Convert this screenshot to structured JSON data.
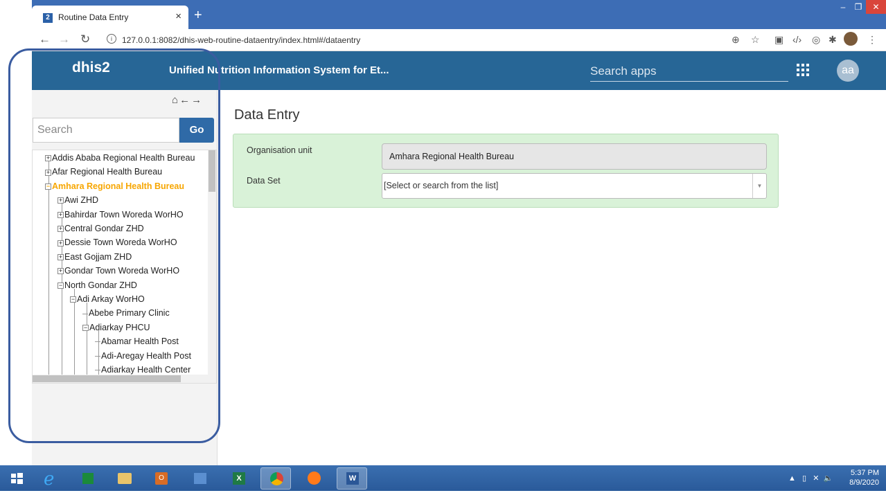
{
  "browser": {
    "tab_number": "2",
    "tab_title": "Routine Data Entry",
    "tab_close": "×",
    "new_tab": "+",
    "url": "127.0.0.1:8082/dhis-web-routine-dataentry/index.html#/dataentry",
    "url_info": "i"
  },
  "header": {
    "logo": "dhis2",
    "title": "Unified Nutrition Information System for Et...",
    "search_placeholder": "Search apps",
    "avatar": "aa"
  },
  "sidebar": {
    "search_placeholder": "Search",
    "go_label": "Go",
    "tree": [
      {
        "label": "Addis Ababa Regional Health Bureau",
        "symbol": "+",
        "level": 0
      },
      {
        "label": "Afar Regional Health Bureau",
        "symbol": "+",
        "level": 0
      },
      {
        "label": "Amhara Regional Health Bureau",
        "symbol": "−",
        "level": 0,
        "active": true
      },
      {
        "label": "Awi ZHD",
        "symbol": "+",
        "level": 1
      },
      {
        "label": "Bahirdar Town Woreda WorHO",
        "symbol": "+",
        "level": 1
      },
      {
        "label": "Central Gondar ZHD",
        "symbol": "+",
        "level": 1
      },
      {
        "label": "Dessie Town Woreda WorHO",
        "symbol": "+",
        "level": 1
      },
      {
        "label": "East Gojjam ZHD",
        "symbol": "+",
        "level": 1
      },
      {
        "label": "Gondar Town Woreda WorHO",
        "symbol": "+",
        "level": 1
      },
      {
        "label": "North Gondar ZHD",
        "symbol": "−",
        "level": 1
      },
      {
        "label": "Adi Arkay WorHO",
        "symbol": "−",
        "level": 2
      },
      {
        "label": "Abebe Primary Clinic",
        "symbol": "",
        "level": 3
      },
      {
        "label": "Adiarkay PHCU",
        "symbol": "−",
        "level": 3
      },
      {
        "label": "Abamar Health Post",
        "symbol": "",
        "level": 4
      },
      {
        "label": "Adi-Aregay Health Post",
        "symbol": "",
        "level": 4
      },
      {
        "label": "Adiarkay Health Center",
        "symbol": "",
        "level": 4
      }
    ]
  },
  "main": {
    "title": "Data Entry",
    "org_unit_label": "Organisation unit",
    "org_unit_value": "Amhara Regional Health Bureau",
    "data_set_label": "Data Set",
    "data_set_placeholder": "[Select or search from the list]"
  },
  "taskbar": {
    "time": "5:37 PM",
    "date": "8/9/2020"
  }
}
